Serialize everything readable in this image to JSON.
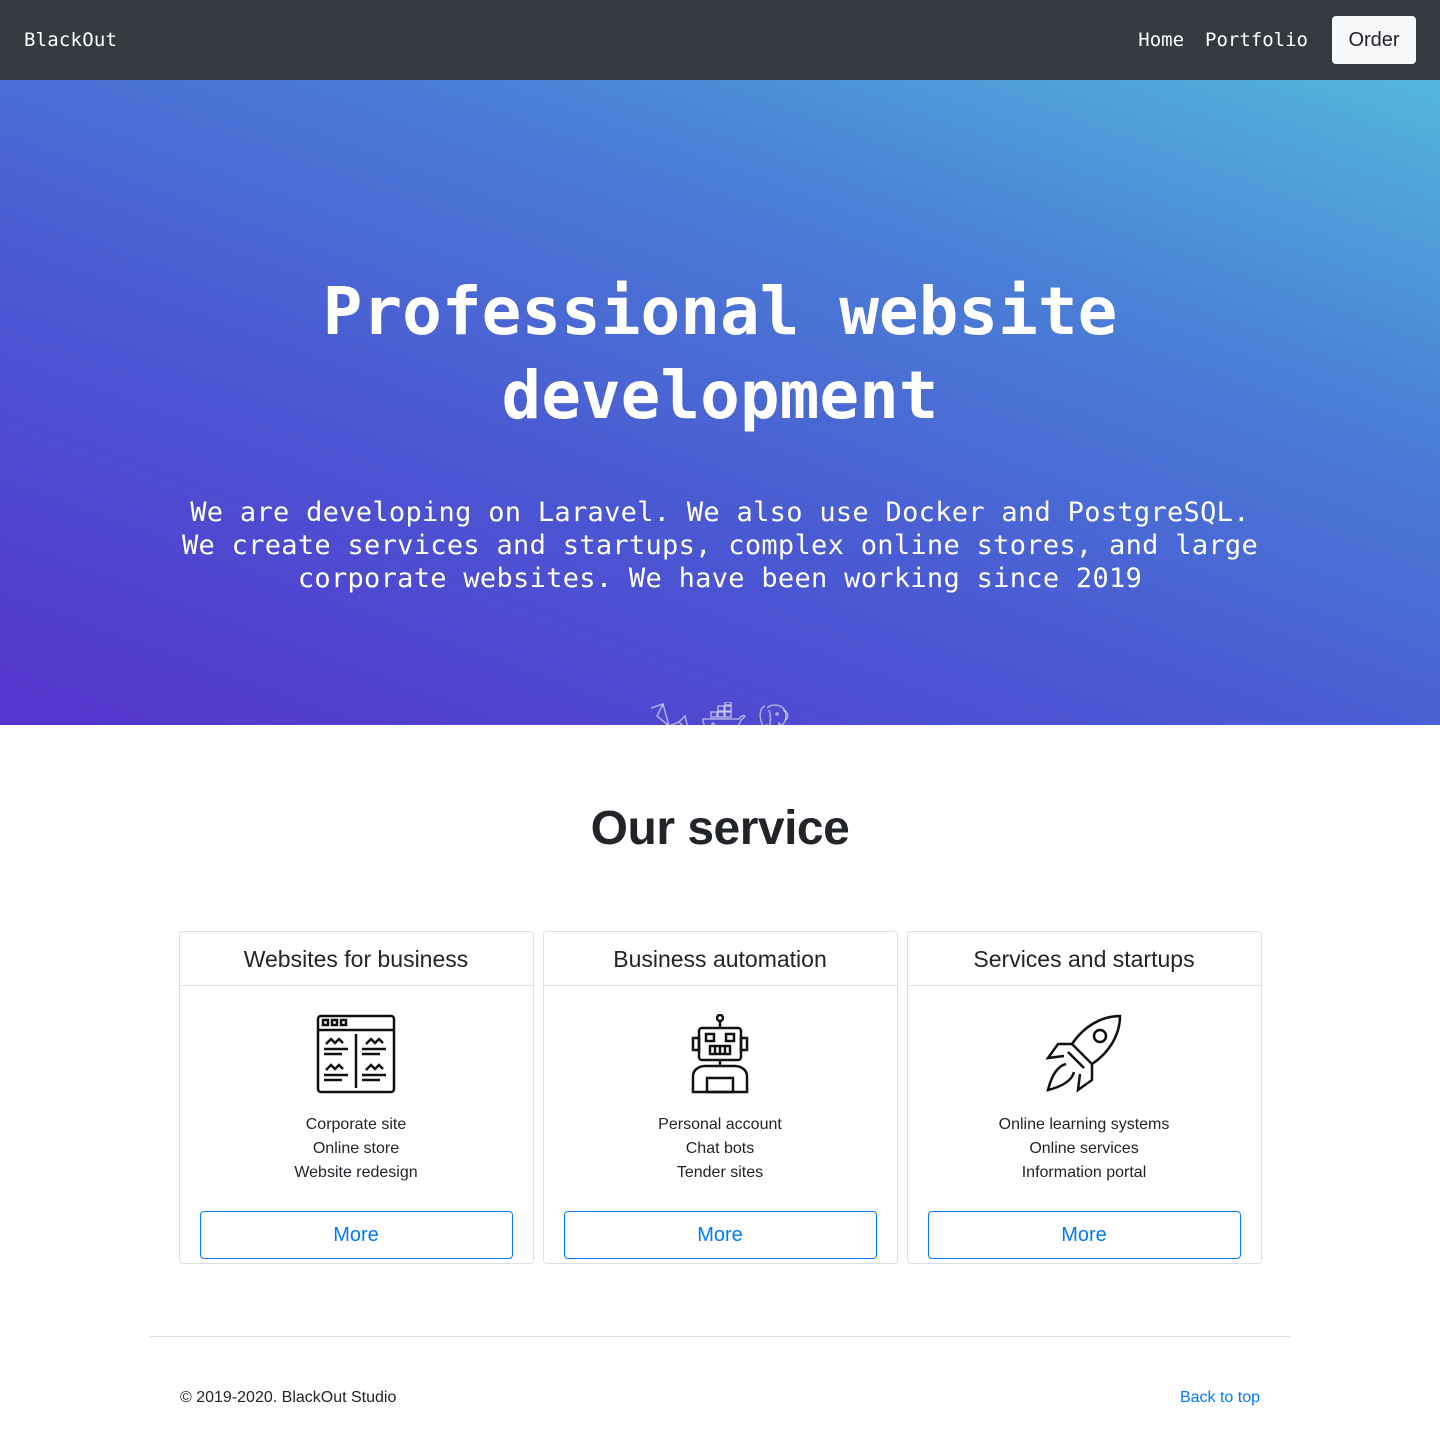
{
  "nav": {
    "brand": "BlackOut",
    "links": [
      "Home",
      "Portfolio"
    ],
    "order_label": "Order"
  },
  "hero": {
    "title": "Professional website development",
    "text": "We are developing on Laravel. We also use Docker and PostgreSQL. We create services and startups, complex online stores, and large corporate websites. We have been working since 2019",
    "icons": [
      "laravel-icon",
      "docker-icon",
      "postgresql-icon"
    ]
  },
  "service": {
    "title": "Our service",
    "cards": [
      {
        "title": "Websites for business",
        "icon": "website-layout-icon",
        "items": [
          "Corporate site",
          "Online store",
          "Website redesign"
        ],
        "button": "More"
      },
      {
        "title": "Business automation",
        "icon": "robot-icon",
        "items": [
          "Personal account",
          "Chat bots",
          "Tender sites"
        ],
        "button": "More"
      },
      {
        "title": "Services and startups",
        "icon": "rocket-icon",
        "items": [
          "Online learning systems",
          "Online services",
          "Information portal"
        ],
        "button": "More"
      }
    ]
  },
  "footer": {
    "copyright": "© 2019-2020. BlackOut Studio",
    "back_to_top": "Back to top"
  },
  "colors": {
    "navbar": "#343a40",
    "link": "#007bff",
    "hero_start": "#5534cc",
    "hero_end": "#53b6db"
  }
}
